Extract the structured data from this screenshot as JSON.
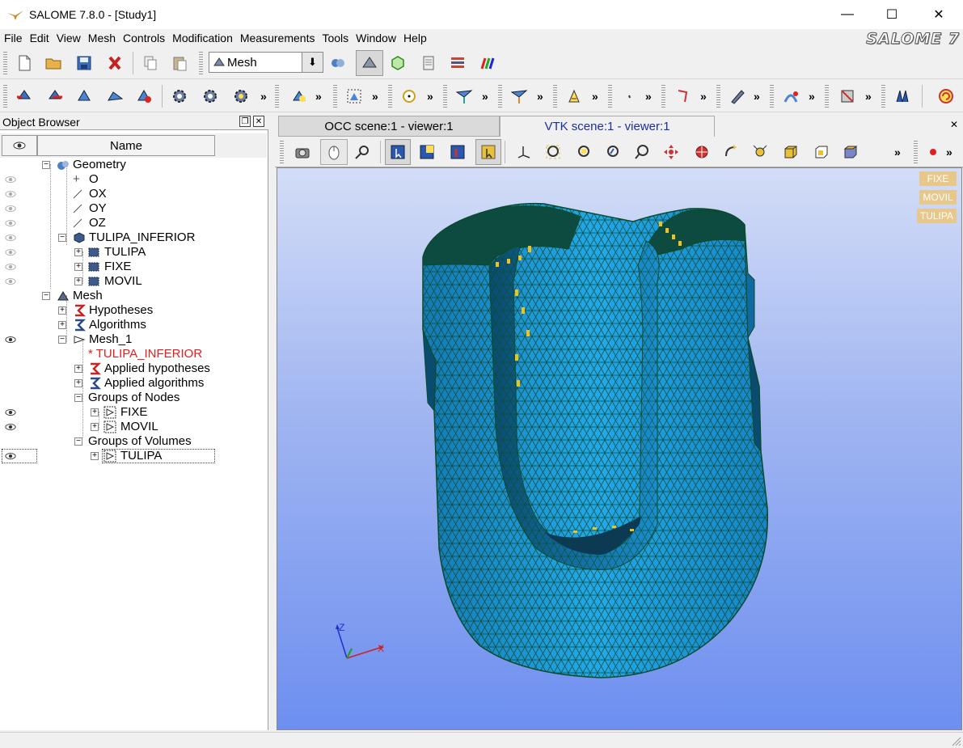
{
  "window": {
    "title": "SALOME 7.8.0 - [Study1]"
  },
  "menu": [
    "File",
    "Edit",
    "View",
    "Mesh",
    "Controls",
    "Modification",
    "Measurements",
    "Tools",
    "Window",
    "Help"
  ],
  "brand": "SALOME 7",
  "toolbar": {
    "module_value": "Mesh"
  },
  "object_browser": {
    "title": "Object Browser",
    "column_name": "Name",
    "tree": [
      {
        "label": "Geometry",
        "depth": 0
      },
      {
        "label": "O",
        "depth": 1
      },
      {
        "label": "OX",
        "depth": 1
      },
      {
        "label": "OY",
        "depth": 1
      },
      {
        "label": "OZ",
        "depth": 1
      },
      {
        "label": "TULIPA_INFERIOR",
        "depth": 1
      },
      {
        "label": "TULIPA",
        "depth": 2
      },
      {
        "label": "FIXE",
        "depth": 2
      },
      {
        "label": "MOVIL",
        "depth": 2
      },
      {
        "label": "Mesh",
        "depth": 0
      },
      {
        "label": "Hypotheses",
        "depth": 1
      },
      {
        "label": "Algorithms",
        "depth": 1
      },
      {
        "label": "Mesh_1",
        "depth": 1
      },
      {
        "label": "* TULIPA_INFERIOR",
        "depth": 2
      },
      {
        "label": "Applied hypotheses",
        "depth": 2
      },
      {
        "label": "Applied algorithms",
        "depth": 2
      },
      {
        "label": "Groups of Nodes",
        "depth": 2
      },
      {
        "label": "FIXE",
        "depth": 3
      },
      {
        "label": "MOVIL",
        "depth": 3
      },
      {
        "label": "Groups of Volumes",
        "depth": 2
      },
      {
        "label": "TULIPA",
        "depth": 3
      }
    ]
  },
  "viewer": {
    "tabs": [
      "OCC scene:1 - viewer:1",
      "VTK scene:1 - viewer:1"
    ],
    "active_tab": "VTK scene:1 - viewer:1",
    "groups_legend": [
      "FIXE",
      "MOVIL",
      "TULIPA"
    ],
    "axes": [
      "Z",
      "X"
    ],
    "colors": {
      "mesh_fill": "#1ea4e6",
      "mesh_edge": "#0b4a2a",
      "legend_badge": "#e8c78a"
    }
  }
}
